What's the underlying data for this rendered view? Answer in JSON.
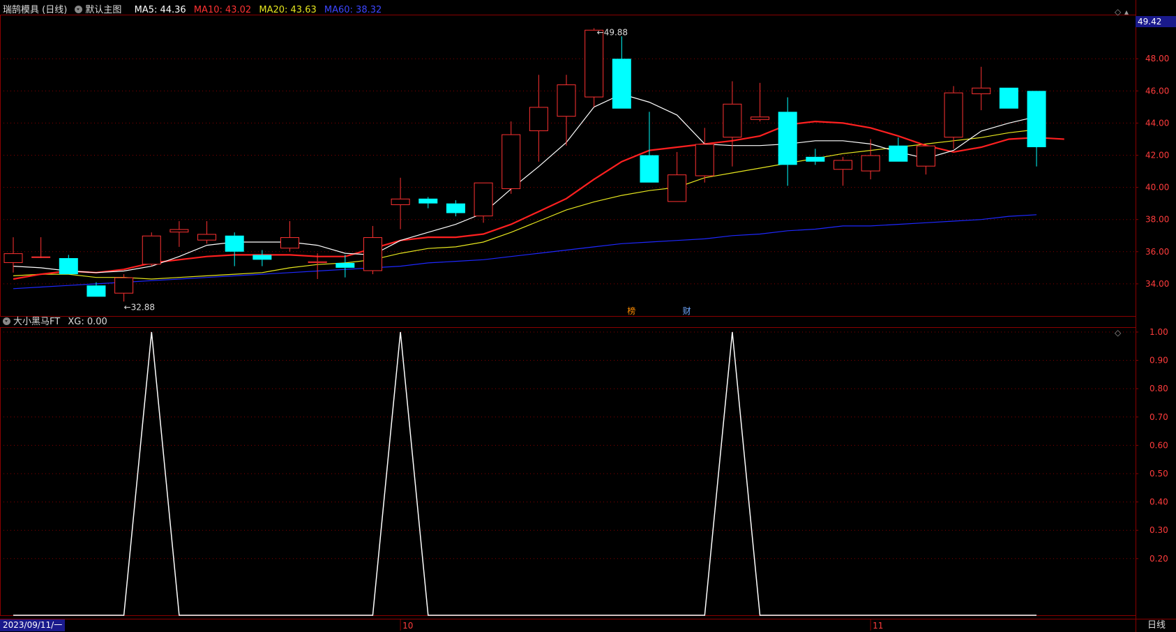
{
  "main_header": {
    "stock_name": "瑞鹄模具 (日线)",
    "chart_name": "默认主图",
    "ma5": "MA5: 44.36",
    "ma10": "MA10: 43.02",
    "ma20": "MA20: 43.63",
    "ma60": "MA60: 38.32"
  },
  "indicator_header": {
    "name": "大小黑马FT",
    "value": "XG: 0.00"
  },
  "price_tag": "49.42",
  "high_marker": "49.88",
  "low_marker": "32.88",
  "period_label": "日线",
  "start_date": "2023/09/11/一",
  "badges": [
    "榜",
    "财"
  ],
  "colors": {
    "up": "#ff3232",
    "down": "#00ffff",
    "ma5": "#ffffff",
    "ma10": "#ff2020",
    "ma20": "#e6e61e",
    "ma60": "#1e28ff",
    "grid": "#8b0000",
    "axis_text": "#ff3c3c"
  },
  "chart_data": [
    {
      "type": "candlestick",
      "y_ticks": [
        "34.00",
        "36.00",
        "38.00",
        "40.00",
        "42.00",
        "44.00",
        "46.00",
        "48.00"
      ],
      "ylim": [
        32.0,
        50.7
      ],
      "x_labels": [
        {
          "label": "10",
          "index": 14
        },
        {
          "label": "11",
          "index": 31
        }
      ],
      "ohlc": [
        [
          35.3,
          36.9,
          34.7,
          35.9
        ],
        [
          35.7,
          36.9,
          35.6,
          35.7
        ],
        [
          35.6,
          35.8,
          34.6,
          34.6
        ],
        [
          33.9,
          34.1,
          33.2,
          33.2
        ],
        [
          33.4,
          34.6,
          32.9,
          34.4
        ],
        [
          35.2,
          37.2,
          35.1,
          37.0
        ],
        [
          37.2,
          37.9,
          36.3,
          37.4
        ],
        [
          36.7,
          37.9,
          36.5,
          37.1
        ],
        [
          37.0,
          37.2,
          35.1,
          36.0
        ],
        [
          35.8,
          36.1,
          35.1,
          35.5
        ],
        [
          36.2,
          37.9,
          36.0,
          36.9
        ],
        [
          35.3,
          35.9,
          34.3,
          35.4
        ],
        [
          35.3,
          35.8,
          34.4,
          35.0
        ],
        [
          34.8,
          37.6,
          34.6,
          36.9
        ],
        [
          38.9,
          40.6,
          37.4,
          39.3
        ],
        [
          39.3,
          39.4,
          38.7,
          39.0
        ],
        [
          39.0,
          39.2,
          38.2,
          38.4
        ],
        [
          38.2,
          40.3,
          37.8,
          40.3
        ],
        [
          39.9,
          44.1,
          39.6,
          43.3
        ],
        [
          43.5,
          47.0,
          41.6,
          45.0
        ],
        [
          44.4,
          47.0,
          42.6,
          46.4
        ],
        [
          45.6,
          49.9,
          45.0,
          49.8
        ],
        [
          48.0,
          49.4,
          44.9,
          44.9
        ],
        [
          42.0,
          44.7,
          40.3,
          40.3
        ],
        [
          39.1,
          42.2,
          39.1,
          40.8
        ],
        [
          40.7,
          43.7,
          40.3,
          42.7
        ],
        [
          43.1,
          46.6,
          41.3,
          45.2
        ],
        [
          44.2,
          46.5,
          44.1,
          44.4
        ],
        [
          44.7,
          45.6,
          40.1,
          41.4
        ],
        [
          41.9,
          42.4,
          41.4,
          41.6
        ],
        [
          41.1,
          41.9,
          40.1,
          41.7
        ],
        [
          41.0,
          43.0,
          40.5,
          42.0
        ],
        [
          42.6,
          43.1,
          41.6,
          41.6
        ],
        [
          41.3,
          42.7,
          40.8,
          42.6
        ],
        [
          43.1,
          46.3,
          42.4,
          45.9
        ],
        [
          45.8,
          47.5,
          44.8,
          46.2
        ],
        [
          46.2,
          46.2,
          44.9,
          44.9
        ],
        [
          46.0,
          46.0,
          41.3,
          42.5
        ]
      ],
      "ma5": [
        35.1,
        35.0,
        34.8,
        34.7,
        34.8,
        35.1,
        35.7,
        36.4,
        36.6,
        36.6,
        36.6,
        36.4,
        35.9,
        35.8,
        36.7,
        37.2,
        37.7,
        38.4,
        39.9,
        41.3,
        42.8,
        45.0,
        45.8,
        45.3,
        44.5,
        42.7,
        42.6,
        42.6,
        42.7,
        42.9,
        42.9,
        42.7,
        42.2,
        41.8,
        42.3,
        43.5,
        44.0,
        44.4
      ],
      "ma10": [
        34.3,
        34.6,
        34.8,
        34.7,
        34.9,
        35.3,
        35.5,
        35.7,
        35.8,
        35.8,
        35.8,
        35.7,
        35.7,
        36.2,
        36.7,
        36.9,
        36.9,
        37.1,
        37.7,
        38.5,
        39.3,
        40.5,
        41.6,
        42.3,
        42.5,
        42.7,
        42.9,
        43.2,
        43.9,
        44.1,
        44.0,
        43.7,
        43.2,
        42.6,
        42.2,
        42.5,
        43.0,
        43.1,
        43.0
      ],
      "ma20": [
        34.5,
        34.6,
        34.6,
        34.4,
        34.4,
        34.3,
        34.4,
        34.5,
        34.6,
        34.7,
        35.0,
        35.2,
        35.3,
        35.5,
        35.9,
        36.2,
        36.3,
        36.6,
        37.2,
        37.9,
        38.6,
        39.1,
        39.5,
        39.8,
        40.0,
        40.6,
        40.9,
        41.2,
        41.5,
        41.8,
        42.1,
        42.3,
        42.5,
        42.7,
        42.9,
        43.1,
        43.4,
        43.6
      ],
      "ma60": [
        33.7,
        33.8,
        33.9,
        34.0,
        34.1,
        34.2,
        34.3,
        34.4,
        34.5,
        34.6,
        34.7,
        34.8,
        34.9,
        35.0,
        35.1,
        35.3,
        35.4,
        35.5,
        35.7,
        35.9,
        36.1,
        36.3,
        36.5,
        36.6,
        36.7,
        36.8,
        37.0,
        37.1,
        37.3,
        37.4,
        37.6,
        37.6,
        37.7,
        37.8,
        37.9,
        38.0,
        38.2,
        38.3
      ]
    },
    {
      "type": "line",
      "name": "XG",
      "y_ticks": [
        "0.20",
        "0.30",
        "0.40",
        "0.50",
        "0.60",
        "0.70",
        "0.80",
        "0.90",
        "1.00"
      ],
      "ylim": [
        0.0,
        1.0
      ],
      "peaks_at_index": [
        5,
        14,
        26
      ],
      "values": [
        0,
        0,
        0,
        0,
        0,
        1,
        0,
        0,
        0,
        0,
        0,
        0,
        0,
        0,
        1,
        0,
        0,
        0,
        0,
        0,
        0,
        0,
        0,
        0,
        0,
        0,
        1,
        0,
        0,
        0,
        0,
        0,
        0,
        0,
        0,
        0,
        0,
        0
      ]
    }
  ]
}
